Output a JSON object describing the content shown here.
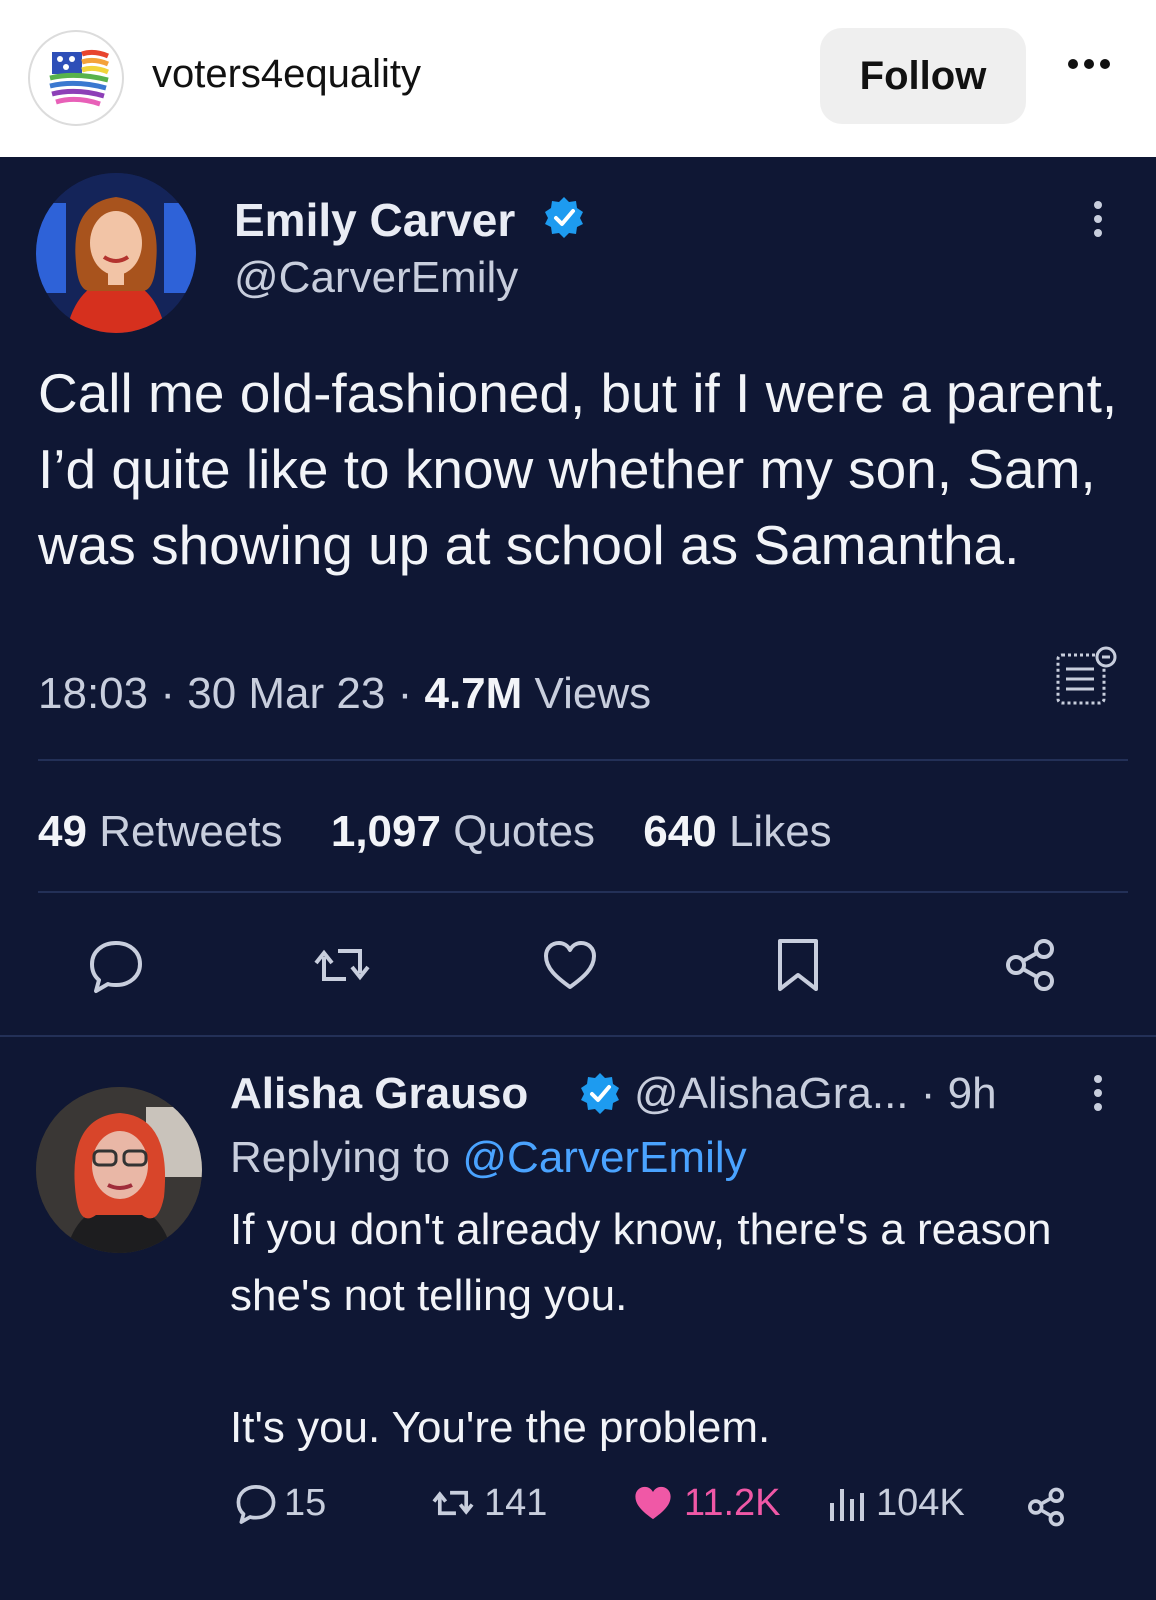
{
  "ig": {
    "username": "voters4equality",
    "follow_label": "Follow",
    "more_icon": "more-horizontal-icon"
  },
  "tweet": {
    "author_name": "Emily Carver",
    "author_handle": "@CarverEmily",
    "text": "Call me old-fashioned, but if I were a parent, I’d quite like to know whether my son, Sam, was showing up at school as Samantha.",
    "time": "18:03",
    "date": "30 Mar 23",
    "views_count": "4.7M",
    "views_label": "Views",
    "sep": "·",
    "retweets_count": "49",
    "retweets_label": "Retweets",
    "quotes_count": "1,097",
    "quotes_label": "Quotes",
    "likes_count": "640",
    "likes_label": "Likes",
    "colors": {
      "background": "#0f1734",
      "verified": "#1d9bf0",
      "link": "#4aa3ff",
      "liked": "#f058a6"
    }
  },
  "reply": {
    "author_name": "Alisha Grauso",
    "author_handle": "@AlishaGra...",
    "age": "· 9h",
    "replying_label": "Replying to",
    "replying_to": "@CarverEmily",
    "text_line1": "If you don't already know, there's a reason she's not telling you.",
    "text_line2": "It's you. You're the problem.",
    "replies": "15",
    "retweets": "141",
    "likes": "11.2K",
    "views": "104K"
  }
}
